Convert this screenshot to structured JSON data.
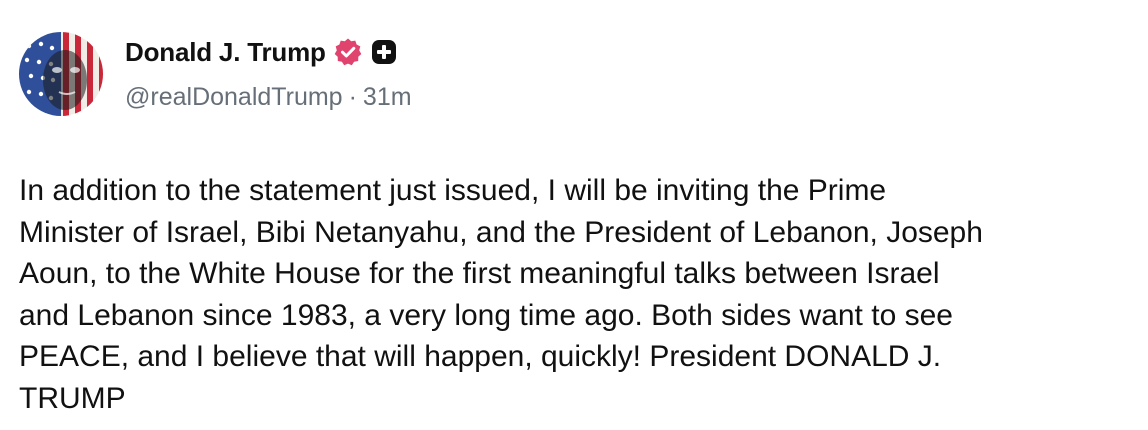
{
  "post": {
    "author": {
      "display_name": "Donald J. Trump",
      "handle": "@realDonaldTrump",
      "separator": "·",
      "time_ago": "31m",
      "verified_icon": "verified-badge-icon",
      "plus_icon": "plus-square-icon"
    },
    "text": "In addition to the statement just issued, I will be inviting the Prime\nMinister of Israel, Bibi Netanyahu, and the President of Lebanon, Joseph\nAoun, to the White House for the first meaningful talks between Israel\nand Lebanon since 1983, a very long time ago. Both sides want to see\nPEACE, and I believe that will happen, quickly! President DONALD J.\nTRUMP"
  },
  "colors": {
    "text": "#111111",
    "secondary_text": "#666f78",
    "verified_badge": "#e0436d",
    "background": "#ffffff"
  }
}
